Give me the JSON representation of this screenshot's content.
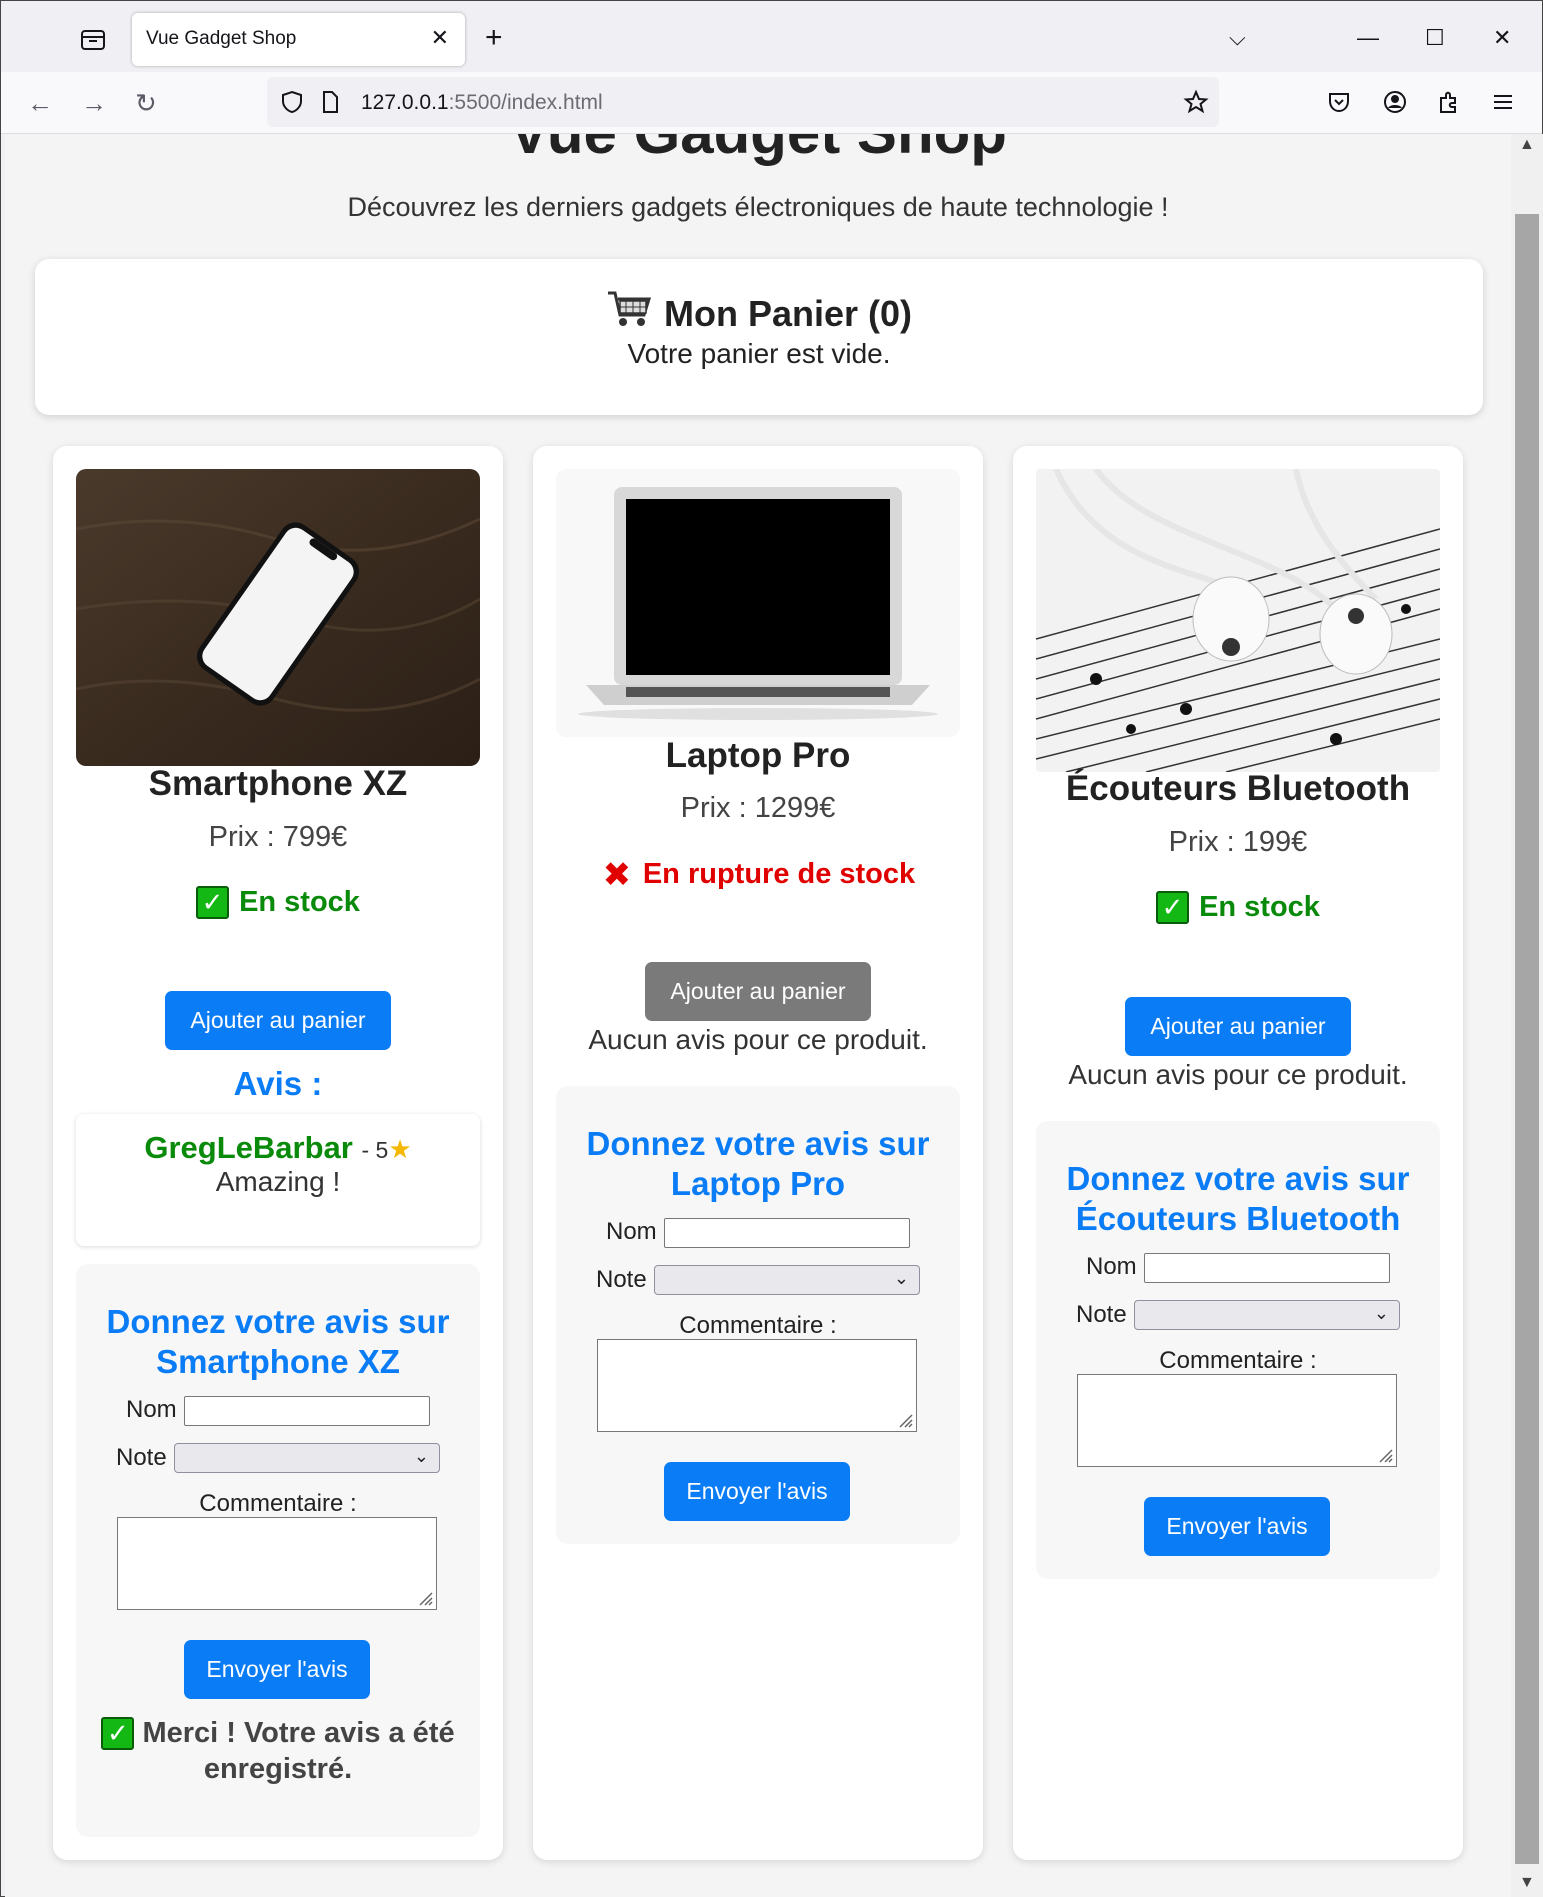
{
  "browser": {
    "tab_title": "Vue Gadget Shop",
    "url_host": "127.0.0.1",
    "url_rest": ":5500/index.html"
  },
  "page": {
    "title": "Vue Gadget Shop",
    "subtitle": "Découvrez les derniers gadgets électroniques de haute technologie !"
  },
  "cart": {
    "title": "Mon Panier (0)",
    "empty_text": "Votre panier est vide."
  },
  "products": [
    {
      "name": "Smartphone XZ",
      "price": "Prix : 799€",
      "stock": "En stock",
      "add_button": "Ajouter au panier",
      "reviews_heading": "Avis :",
      "review": {
        "author": "GregLeBarbar",
        "rating": "- 5",
        "text": "Amazing !"
      },
      "form_heading": "Donnez votre avis sur Smartphone XZ",
      "name_label": "Nom",
      "rating_label": "Note",
      "comment_label": "Commentaire :",
      "submit_button": "Envoyer l'avis",
      "thanks": "Merci ! Votre avis a été enregistré."
    },
    {
      "name": "Laptop Pro",
      "price": "Prix : 1299€",
      "stock": "En rupture de stock",
      "add_button": "Ajouter au panier",
      "no_reviews": "Aucun avis pour ce produit.",
      "form_heading": "Donnez votre avis sur Laptop Pro",
      "name_label": "Nom",
      "rating_label": "Note",
      "comment_label": "Commentaire :",
      "submit_button": "Envoyer l'avis"
    },
    {
      "name": "Écouteurs Bluetooth",
      "price": "Prix : 199€",
      "stock": "En stock",
      "add_button": "Ajouter au panier",
      "no_reviews": "Aucun avis pour ce produit.",
      "form_heading": "Donnez votre avis sur Écouteurs Bluetooth",
      "name_label": "Nom",
      "rating_label": "Note",
      "comment_label": "Commentaire :",
      "submit_button": "Envoyer l'avis"
    }
  ],
  "colors": {
    "accent": "#0a7cf5",
    "in_stock": "#0a8a0a",
    "out_of_stock": "#e00000",
    "disabled_button": "#7a7a7a"
  }
}
